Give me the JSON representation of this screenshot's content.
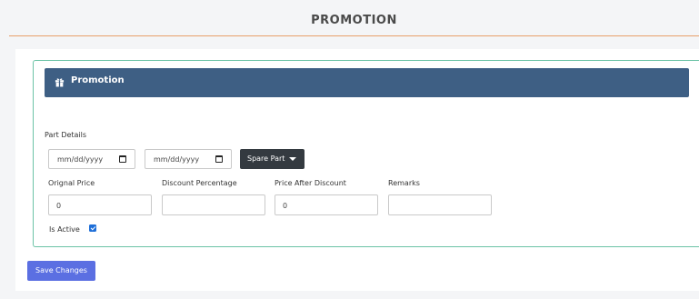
{
  "page": {
    "title": "PROMOTION"
  },
  "card": {
    "title": "Promotion",
    "icon": "gift-icon"
  },
  "part_details": {
    "label": "Part Details",
    "date_from_placeholder": "mm/dd/yyyy",
    "date_to_placeholder": "mm/dd/yyyy",
    "dropdown_label": "Spare Part"
  },
  "fields": {
    "original_price": {
      "label": "Orignal Price",
      "value": "0"
    },
    "discount_percentage": {
      "label": "Discount Percentage",
      "value": ""
    },
    "price_after_discount": {
      "label": "Price After Discount",
      "value": "0"
    },
    "remarks": {
      "label": "Remarks",
      "value": ""
    }
  },
  "is_active": {
    "label": "Is Active",
    "checked": true
  },
  "actions": {
    "save_label": "Save Changes"
  },
  "colors": {
    "header_bg": "#3e5f84",
    "card_border": "#6cc3a6",
    "save_button": "#5b6fe2",
    "dropdown_bg": "#343a40",
    "title_underline": "#e8a06a"
  }
}
